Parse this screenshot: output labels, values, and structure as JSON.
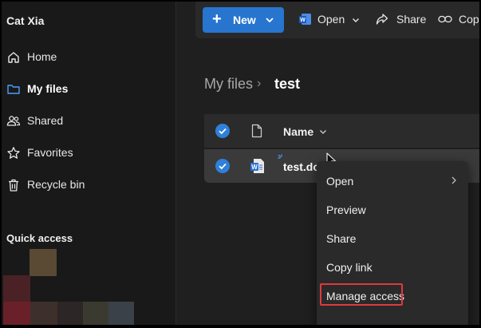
{
  "user": {
    "name": "Cat Xia"
  },
  "sidebar": {
    "items": [
      {
        "label": "Home",
        "icon": "home-icon"
      },
      {
        "label": "My files",
        "icon": "folder-icon",
        "active": true
      },
      {
        "label": "Shared",
        "icon": "people-icon"
      },
      {
        "label": "Favorites",
        "icon": "star-icon"
      },
      {
        "label": "Recycle bin",
        "icon": "trash-icon"
      }
    ],
    "quick_access_title": "Quick access"
  },
  "toolbar": {
    "new_label": "New",
    "open_label": "Open",
    "share_label": "Share",
    "copy_label": "Cop"
  },
  "breadcrumb": {
    "root": "My files",
    "current": "test"
  },
  "table": {
    "name_header": "Name",
    "rows": [
      {
        "name": "test.do",
        "selected": true
      }
    ]
  },
  "context_menu": {
    "items": [
      {
        "label": "Open",
        "has_submenu": true
      },
      {
        "label": "Preview"
      },
      {
        "label": "Share"
      },
      {
        "label": "Copy link"
      },
      {
        "label": "Manage access",
        "highlighted": true
      }
    ]
  },
  "colors": {
    "accent": "#2775cf",
    "highlight_border": "#e0393e",
    "word_blue": "#2b6fd6"
  }
}
